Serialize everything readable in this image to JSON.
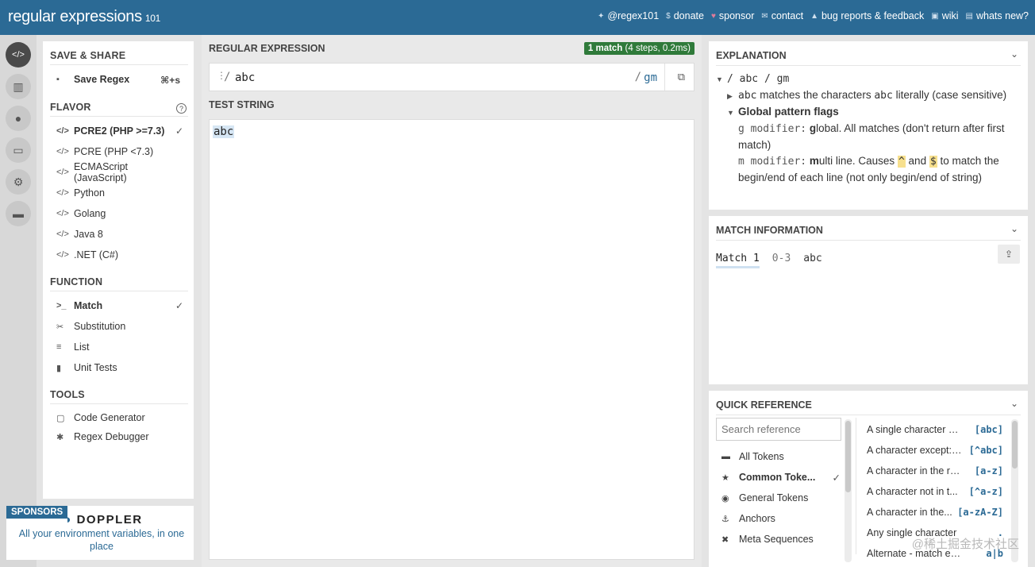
{
  "header": {
    "logo": "regular expressions",
    "logo_version": "101",
    "links": [
      {
        "icon": "twitter-icon",
        "glyph": "✦",
        "label": "@regex101"
      },
      {
        "icon": "dollar-icon",
        "glyph": "$",
        "label": "donate"
      },
      {
        "icon": "heart-icon",
        "glyph": "♥",
        "label": "sponsor"
      },
      {
        "icon": "mail-icon",
        "glyph": "✉",
        "label": "contact"
      },
      {
        "icon": "warning-icon",
        "glyph": "▲",
        "label": "bug reports & feedback"
      },
      {
        "icon": "wiki-icon",
        "glyph": "▣",
        "label": "wiki"
      },
      {
        "icon": "news-icon",
        "glyph": "▤",
        "label": "whats new?"
      }
    ]
  },
  "rail": [
    {
      "icon": "code-icon",
      "glyph": "</>",
      "active": true
    },
    {
      "icon": "library-icon",
      "glyph": "▥"
    },
    {
      "icon": "user-icon",
      "glyph": "●"
    },
    {
      "icon": "quiz-icon",
      "glyph": "▭"
    },
    {
      "icon": "gear-icon",
      "glyph": "⚙"
    },
    {
      "icon": "chat-icon",
      "glyph": "▬"
    }
  ],
  "left": {
    "save_share": "SAVE & SHARE",
    "save_regex": "Save Regex",
    "save_shortcut": "⌘+s",
    "flavor": "FLAVOR",
    "flavors": [
      {
        "label": "PCRE2 (PHP >=7.3)",
        "selected": true
      },
      {
        "label": "PCRE (PHP <7.3)"
      },
      {
        "label": "ECMAScript (JavaScript)"
      },
      {
        "label": "Python"
      },
      {
        "label": "Golang"
      },
      {
        "label": "Java 8"
      },
      {
        "label": ".NET (C#)"
      }
    ],
    "function": "FUNCTION",
    "functions": [
      {
        "label": "Match",
        "icon": "terminal-icon",
        "glyph": ">_",
        "selected": true
      },
      {
        "label": "Substitution",
        "icon": "scissors-icon",
        "glyph": "✂"
      },
      {
        "label": "List",
        "icon": "list-icon",
        "glyph": "≡"
      },
      {
        "label": "Unit Tests",
        "icon": "flask-icon",
        "glyph": "▮"
      }
    ],
    "tools": "TOOLS",
    "tool_items": [
      {
        "label": "Code Generator",
        "icon": "file-code-icon",
        "glyph": "▢"
      },
      {
        "label": "Regex Debugger",
        "icon": "bug-icon",
        "glyph": "✱"
      }
    ]
  },
  "sponsor": {
    "tag": "SPONSORS",
    "brand": "DOPPLER",
    "desc": "All your environment variables, in one place"
  },
  "center": {
    "regex_title": "REGULAR EXPRESSION",
    "match_count": "1 match",
    "match_detail": "(4 steps, 0.2ms)",
    "delimiter_open": "/",
    "pattern": "abc",
    "delimiter_close": "/",
    "flags": "gm",
    "test_title": "TEST STRING",
    "test_string": "abc"
  },
  "explanation": {
    "title": "EXPLANATION",
    "line1": "/ abc / gm",
    "l2_code": "abc",
    "l2_mid": "matches the characters",
    "l2_code2": "abc",
    "l2_end": "literally (case sensitive)",
    "flags_heading": "Global pattern flags",
    "g_code": "g modifier:",
    "g_bold": "g",
    "g_text": "lobal. All matches (don't return after first match)",
    "m_code": "m modifier:",
    "m_bold": "m",
    "m_text1": "ulti line. Causes",
    "caret": "^",
    "and": "and",
    "dollar": "$",
    "m_text2": "to match the begin/end of each line (not only begin/end of string)"
  },
  "match_info": {
    "title": "MATCH INFORMATION",
    "match_label": "Match 1",
    "range": "0-3",
    "value": "abc"
  },
  "quick_ref": {
    "title": "QUICK REFERENCE",
    "search_placeholder": "Search reference",
    "categories": [
      {
        "label": "All Tokens",
        "icon": "stack-icon",
        "glyph": "▬"
      },
      {
        "label": "Common Toke...",
        "icon": "star-icon",
        "glyph": "★",
        "selected": true
      },
      {
        "label": "General Tokens",
        "icon": "circle-dot-icon",
        "glyph": "◉"
      },
      {
        "label": "Anchors",
        "icon": "anchor-icon",
        "glyph": "⚓"
      },
      {
        "label": "Meta Sequences",
        "icon": "x-circle-icon",
        "glyph": "✖"
      }
    ],
    "refs": [
      {
        "desc": "A single character of: ...",
        "code": "[abc]"
      },
      {
        "desc": "A character except: ...",
        "code": "[^abc]"
      },
      {
        "desc": "A character in the ran...",
        "code": "[a-z]"
      },
      {
        "desc": "A character not in t...",
        "code": "[^a-z]"
      },
      {
        "desc": "A character in the...",
        "code": "[a-zA-Z]"
      },
      {
        "desc": "Any single character",
        "code": "."
      },
      {
        "desc": "Alternate - match either ...",
        "code": "a|b"
      }
    ]
  },
  "watermark": "@稀土掘金技术社区"
}
